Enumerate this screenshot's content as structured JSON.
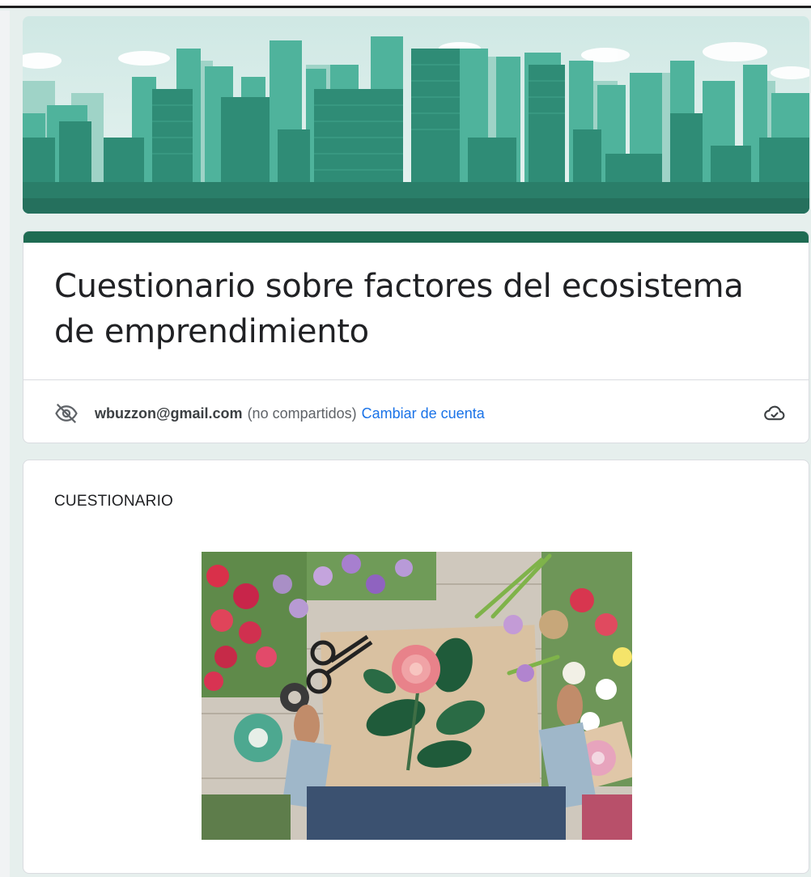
{
  "form": {
    "title": "Cuestionario sobre factores del ecosistema de emprendimiento",
    "accent_color": "#1e6b52"
  },
  "account": {
    "email": "wbuzzon@gmail.com",
    "shared_note": "(no compartidos)",
    "switch_label": "Cambiar de cuenta",
    "visibility_icon": "eye-off-icon",
    "save_status_icon": "cloud-check-icon"
  },
  "section": {
    "title": "CUESTIONARIO",
    "image_description": "flowers"
  },
  "header": {
    "image": "city-skyline"
  }
}
